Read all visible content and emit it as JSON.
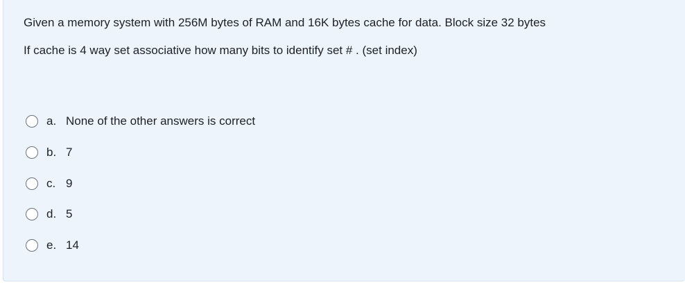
{
  "question": {
    "line1": "Given a memory system with 256M bytes of RAM and 16K bytes cache for data. Block size 32 bytes",
    "line2": "If cache is 4 way set associative how many bits to identify set # . (set index)"
  },
  "answers": [
    {
      "letter": "a.",
      "text": "None of the other answers is correct",
      "selected": false
    },
    {
      "letter": "b.",
      "text": "7",
      "selected": false
    },
    {
      "letter": "c.",
      "text": "9",
      "selected": false
    },
    {
      "letter": "d.",
      "text": "5",
      "selected": false
    },
    {
      "letter": "e.",
      "text": "14",
      "selected": false
    }
  ],
  "colors": {
    "card_background": "#eef4fc",
    "text": "#1d2125",
    "radio_border": "#6a737b"
  }
}
